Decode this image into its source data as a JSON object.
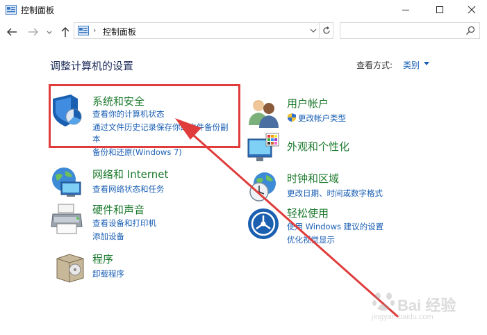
{
  "window": {
    "title": "控制面板"
  },
  "address": {
    "separator": "›",
    "path": "控制面板"
  },
  "header": {
    "title": "调整计算机的设置",
    "view_label": "查看方式:",
    "view_value": "类别"
  },
  "categories": {
    "system": {
      "title": "系统和安全",
      "links": [
        "查看你的计算机状态",
        "通过文件历史记录保存你的文件备份副",
        "本",
        "备份和还原(Windows 7)"
      ]
    },
    "network": {
      "title": "网络和 Internet",
      "links": [
        "查看网络状态和任务"
      ]
    },
    "hardware": {
      "title": "硬件和声音",
      "links": [
        "查看设备和打印机",
        "添加设备"
      ]
    },
    "programs": {
      "title": "程序",
      "links": [
        "卸载程序"
      ]
    },
    "users": {
      "title": "用户帐户",
      "links": [
        "更改帐户类型"
      ]
    },
    "appearance": {
      "title": "外观和个性化",
      "links": []
    },
    "clock": {
      "title": "时钟和区域",
      "links": [
        "更改日期、时间或数字格式"
      ]
    },
    "ease": {
      "title": "轻松使用",
      "links": [
        "使用 Windows 建议的设置",
        "优化视觉显示"
      ]
    }
  },
  "watermark": {
    "brand": "Bai 经验",
    "url": "jingyan.baidu.com"
  },
  "colors": {
    "category_title": "#1e7b2f",
    "link": "#1a5fb4",
    "annotation": "#e03c3c"
  }
}
